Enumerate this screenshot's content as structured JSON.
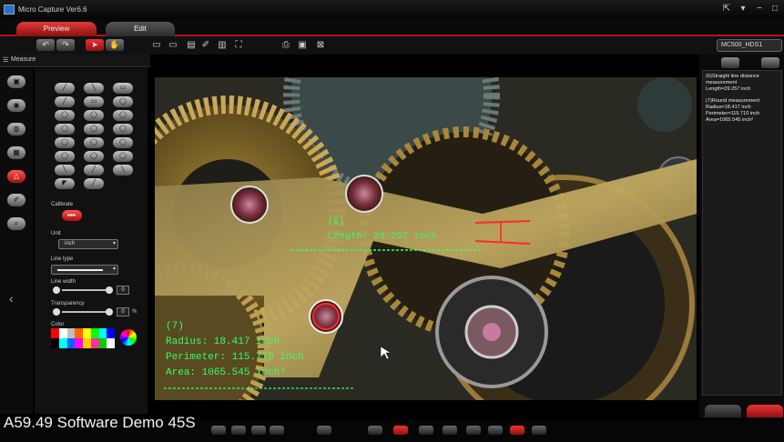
{
  "app": {
    "title": "Micro Capture Ver6.6"
  },
  "window_controls": [
    "⇱",
    "▾",
    "−",
    "□"
  ],
  "tabs": [
    {
      "label": "Preview",
      "active": true
    },
    {
      "label": "Edit",
      "active": false
    }
  ],
  "toolbar": {
    "undo": "↶",
    "redo": "↷",
    "select": "➤",
    "pan": "✋",
    "icons": [
      "▭",
      "▭",
      "▤",
      "✐",
      "▥",
      "⛶",
      "⎙",
      "▣",
      "⊠"
    ],
    "device": "MC500_HDS1"
  },
  "measure_panel": {
    "header": "Measure",
    "header_icon": "☰",
    "left_icons": [
      "▣",
      "◉",
      "◍",
      "▦",
      "△",
      "✐",
      "⌕"
    ],
    "tool_grid": [
      "╱",
      "╲",
      "▭",
      "╱",
      "▭",
      "◯",
      "◯",
      "◯",
      "◯",
      "◯",
      "◯",
      "◯",
      "◯",
      "◯",
      "◯",
      "◯",
      "◯",
      "◯",
      "╲",
      "╱",
      "╲",
      "◤",
      "╱"
    ],
    "calibrate_label": "Calibrate",
    "calibrate_button": "▸▸▸",
    "unit_label": "Unit",
    "unit_value": "inch",
    "line_type_label": "Line type",
    "line_width_label": "Line width",
    "line_width_value": "0",
    "transparency_label": "Transparency",
    "transparency_value": "0",
    "transparency_unit": "%",
    "color_label": "Color",
    "palette": [
      "#ff0000",
      "#ffffff",
      "#c0c0c0",
      "#ff6600",
      "#ffff00",
      "#00ff00",
      "#00ffff",
      "#0000ff",
      "#000000",
      "#00ffff",
      "#0066ff",
      "#ff00ff",
      "#ffcc00",
      "#ff3399",
      "#00cc00",
      "#ffffff"
    ]
  },
  "overlays": {
    "line_label": "(6)",
    "line_text": "Length: 29.257 inch",
    "circle_label": "(7)",
    "radius_text": "Radius: 18.417 inch",
    "perimeter_text": "Perimeter: 115.710 inch",
    "area_text": "Area: 1065.545 inch²"
  },
  "results": [
    "(6)Straight line distance measurement\nLength=29.257 inch",
    "(7)Round measurement\nRadius=18.417 inch\nPerimeter=115.710 inch\nArea=1065.545 inch²"
  ],
  "colors": {
    "accent_red": "#c81e1e",
    "overlay_green": "#33ff66",
    "measure_red": "#ff2a2a"
  },
  "caption": "A59.49 Software Demo 45S"
}
